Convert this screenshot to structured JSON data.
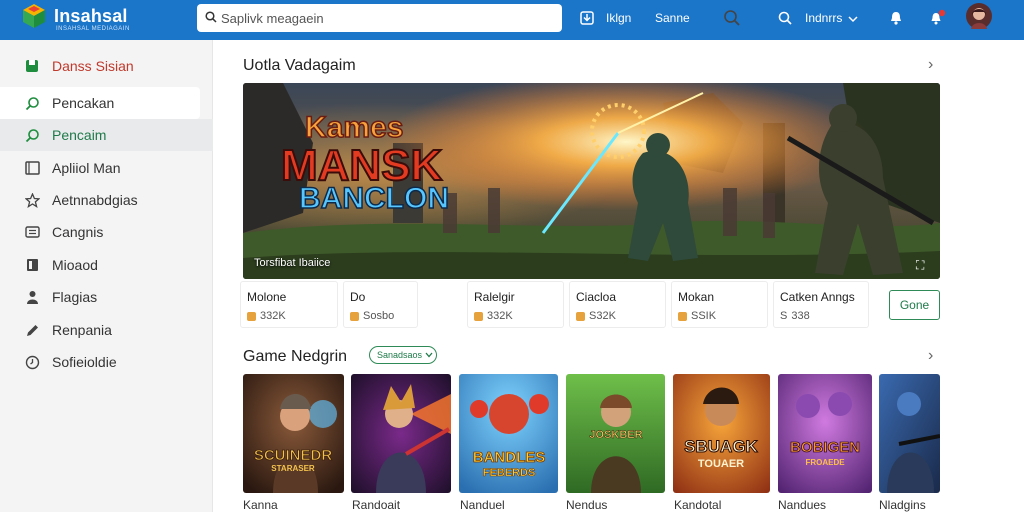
{
  "topbar": {
    "brand": "Insahsal",
    "brand_sub": "INSAHSAL MEDIAGAIN",
    "search_placeholder": "Saplivk meagaein",
    "nav_item_1": "Iklgn",
    "nav_item_2": "Sanne",
    "user_label": "Indnrrs",
    "bg_color": "#1b75c9"
  },
  "sidebar": {
    "items": [
      {
        "label": "Danss Sisian",
        "icon": "bookmark-icon"
      },
      {
        "label": "Pencakan",
        "icon": "search-icon"
      },
      {
        "label": "Pencaim",
        "icon": "search-icon"
      },
      {
        "label": "Apliiol Man",
        "icon": "monitor-icon"
      },
      {
        "label": "Aetnnabdgias",
        "icon": "star-icon"
      },
      {
        "label": "Cangnis",
        "icon": "list-icon"
      },
      {
        "label": "Mioaod",
        "icon": "bookmark-icon"
      },
      {
        "label": "Flagias",
        "icon": "person-icon"
      },
      {
        "label": "Renpania",
        "icon": "pencil-icon"
      },
      {
        "label": "Sofieioldie",
        "icon": "clock-icon"
      }
    ]
  },
  "featured": {
    "title": "Uotla Vadagaim",
    "banner_text_1": "Kames",
    "banner_text_2": "MANSK",
    "banner_text_3": "BANCLON",
    "caption": "Torsfibat Ibaiice"
  },
  "categories": [
    {
      "title": "Molone",
      "stat": "332K"
    },
    {
      "title": "Do",
      "stat": "Sosbo"
    },
    {
      "title": "Ralelgir",
      "stat": "332K"
    },
    {
      "title": "Ciacloa",
      "stat": "S32K"
    },
    {
      "title": "Mokan",
      "stat": "SSIK"
    },
    {
      "title": "Catken Anngs",
      "stat": "338"
    }
  ],
  "more_button": "Gone",
  "games_section": {
    "title": "Game Nedgrin",
    "filter": "Sanadsaos",
    "games": [
      {
        "name": "Kanna",
        "art_text": "SCUINEDR",
        "art_sub": "STARASER"
      },
      {
        "name": "Randoait",
        "art_text": "",
        "art_sub": ""
      },
      {
        "name": "Nanduel",
        "art_text": "BANDLES",
        "art_sub": "FEBERDS"
      },
      {
        "name": "Nendus",
        "art_text": "JOSKBER",
        "art_sub": ""
      },
      {
        "name": "Kandotal",
        "art_text": "SBUAGK",
        "art_sub": "TOUAER"
      },
      {
        "name": "Nandues",
        "art_text": "BOBIGEN",
        "art_sub": "FROAEDE"
      },
      {
        "name": "Nladgins",
        "art_text": "",
        "art_sub": ""
      }
    ]
  }
}
